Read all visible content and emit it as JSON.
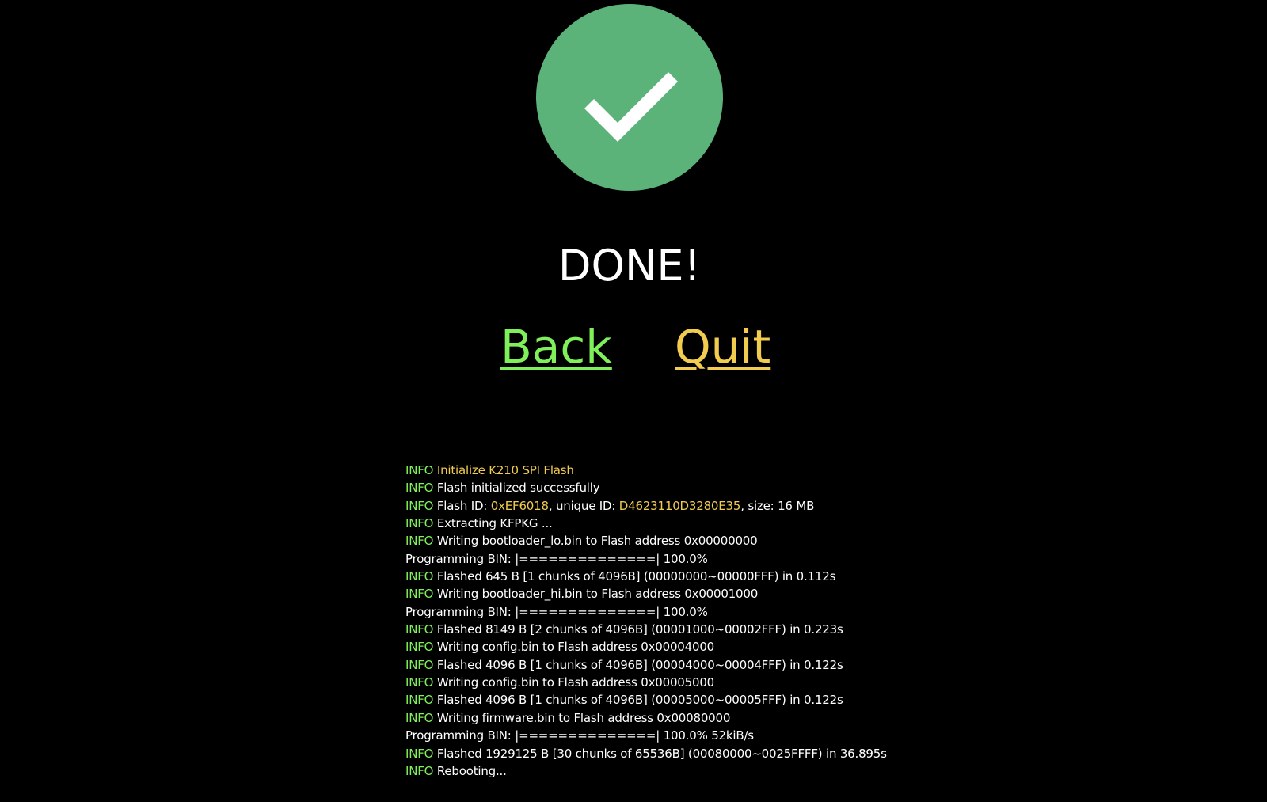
{
  "status": {
    "icon": "checkmark-icon",
    "circle_color": "#5cb37a",
    "title": "DONE!"
  },
  "nav": {
    "back_label": "Back",
    "quit_label": "Quit",
    "back_color": "#7ff05a",
    "quit_color": "#f2cc4e"
  },
  "log": {
    "level_color": "#7ff05a",
    "highlight_color": "#f2cc4e",
    "lines": [
      {
        "level": "INFO",
        "segments": [
          {
            "text": "Initialize K210 SPI Flash",
            "hl": true
          }
        ]
      },
      {
        "level": "INFO",
        "segments": [
          {
            "text": "Flash initialized successfully",
            "hl": false
          }
        ]
      },
      {
        "level": "INFO",
        "segments": [
          {
            "text": "Flash ID: ",
            "hl": false
          },
          {
            "text": "0xEF6018",
            "hl": true
          },
          {
            "text": ", unique ID: ",
            "hl": false
          },
          {
            "text": "D4623110D3280E35",
            "hl": true
          },
          {
            "text": ", size: 16 MB",
            "hl": false
          }
        ]
      },
      {
        "level": "INFO",
        "segments": [
          {
            "text": "Extracting KFPKG ...",
            "hl": false
          }
        ]
      },
      {
        "level": "INFO",
        "segments": [
          {
            "text": "Writing bootloader_lo.bin to Flash address 0x00000000",
            "hl": false
          }
        ]
      },
      {
        "level": "",
        "segments": [
          {
            "text": "Programming BIN: |==============| 100.0%",
            "hl": false
          }
        ]
      },
      {
        "level": "INFO",
        "segments": [
          {
            "text": "Flashed 645 B [1 chunks of 4096B] (00000000~00000FFF) in 0.112s",
            "hl": false
          }
        ]
      },
      {
        "level": "INFO",
        "segments": [
          {
            "text": "Writing bootloader_hi.bin to Flash address 0x00001000",
            "hl": false
          }
        ]
      },
      {
        "level": "",
        "segments": [
          {
            "text": "Programming BIN: |==============| 100.0%",
            "hl": false
          }
        ]
      },
      {
        "level": "INFO",
        "segments": [
          {
            "text": "Flashed 8149 B [2 chunks of 4096B] (00001000~00002FFF) in 0.223s",
            "hl": false
          }
        ]
      },
      {
        "level": "INFO",
        "segments": [
          {
            "text": "Writing config.bin to Flash address 0x00004000",
            "hl": false
          }
        ]
      },
      {
        "level": "INFO",
        "segments": [
          {
            "text": "Flashed 4096 B [1 chunks of 4096B] (00004000~00004FFF) in 0.122s",
            "hl": false
          }
        ]
      },
      {
        "level": "INFO",
        "segments": [
          {
            "text": "Writing config.bin to Flash address 0x00005000",
            "hl": false
          }
        ]
      },
      {
        "level": "INFO",
        "segments": [
          {
            "text": "Flashed 4096 B [1 chunks of 4096B] (00005000~00005FFF) in 0.122s",
            "hl": false
          }
        ]
      },
      {
        "level": "INFO",
        "segments": [
          {
            "text": "Writing firmware.bin to Flash address 0x00080000",
            "hl": false
          }
        ]
      },
      {
        "level": "",
        "segments": [
          {
            "text": "Programming BIN: |==============| 100.0% 52kiB/s",
            "hl": false
          }
        ]
      },
      {
        "level": "INFO",
        "segments": [
          {
            "text": "Flashed 1929125 B [30 chunks of 65536B] (00080000~0025FFFF) in 36.895s",
            "hl": false
          }
        ]
      },
      {
        "level": "INFO",
        "segments": [
          {
            "text": "Rebooting...",
            "hl": false
          }
        ]
      }
    ]
  }
}
